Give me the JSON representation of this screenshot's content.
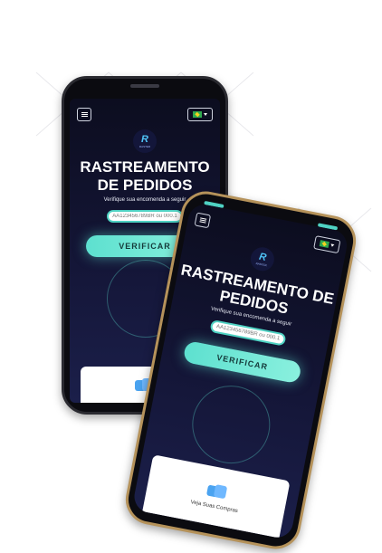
{
  "brand": {
    "logo_text": "RASTER"
  },
  "header": {
    "menu_icon": "menu-icon",
    "language_icon": "brazil-flag-icon"
  },
  "hero": {
    "title": "RASTREAMENTO DE PEDIDOS",
    "subtitle": "Verifique sua encomenda a seguir"
  },
  "tracking": {
    "placeholder": "AA123456789BR ou 000.1",
    "button_label": "VERIFICAR"
  },
  "card": {
    "icon": "boxes-icon",
    "label": "Veja Suas Compras"
  },
  "colors": {
    "accent": "#5de0cf",
    "background": "#0c0d1f",
    "button": "#8af0de"
  }
}
